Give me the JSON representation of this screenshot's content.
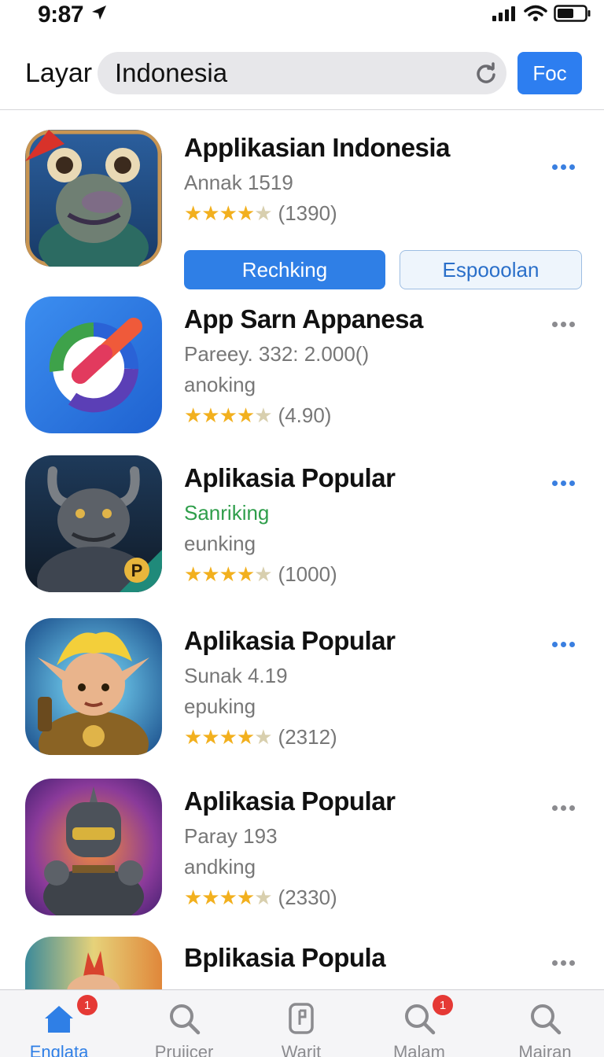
{
  "status_bar": {
    "time": "9:87"
  },
  "header": {
    "left_label": "Layar",
    "search_value": "Indonesia",
    "go_label": "Foc"
  },
  "apps": [
    {
      "title": "Applikasian Indonesia",
      "subtitle": "Annak 1519",
      "rating": 4.5,
      "rating_count": "(1390)",
      "primary_action": "Rechking",
      "secondary_action": "Espooolan",
      "more_color": "blue"
    },
    {
      "title": "App Sarn Appanesa",
      "subtitle": "Pareey. 332: 2.000()",
      "category": "anoking",
      "rating": 4.5,
      "rating_count": "(4.90)",
      "more_color": "gray"
    },
    {
      "title": "Aplikasia Popular",
      "subtitle": "Sanriking",
      "subtitle_color": "#2f9e4b",
      "category": "eunking",
      "rating": 4,
      "rating_count": "(1000)",
      "more_color": "blue"
    },
    {
      "title": "Aplikasia Popular",
      "subtitle": "Sunak 4.19",
      "category": "epuking",
      "rating": 4.5,
      "rating_count": "(2312)",
      "more_color": "blue"
    },
    {
      "title": "Aplikasia Popular",
      "subtitle": "Paray 193",
      "category": "andking",
      "rating": 4.5,
      "rating_count": "(2330)",
      "more_color": "gray"
    },
    {
      "title": "Bplikasia Popula",
      "more_color": "gray"
    }
  ],
  "tabs": [
    {
      "label": "Englata",
      "icon": "home-icon",
      "badge": "1",
      "active": true
    },
    {
      "label": "Pruiicer",
      "icon": "search-icon",
      "active": false
    },
    {
      "label": "Warit",
      "icon": "device-icon",
      "active": false
    },
    {
      "label": "Malam",
      "icon": "search-icon",
      "badge": "1",
      "active": false
    },
    {
      "label": "Mairan",
      "icon": "search-icon",
      "active": false
    }
  ],
  "colors": {
    "accent": "#2f7fe6",
    "star": "#f2b01e",
    "badge": "#e53935"
  }
}
